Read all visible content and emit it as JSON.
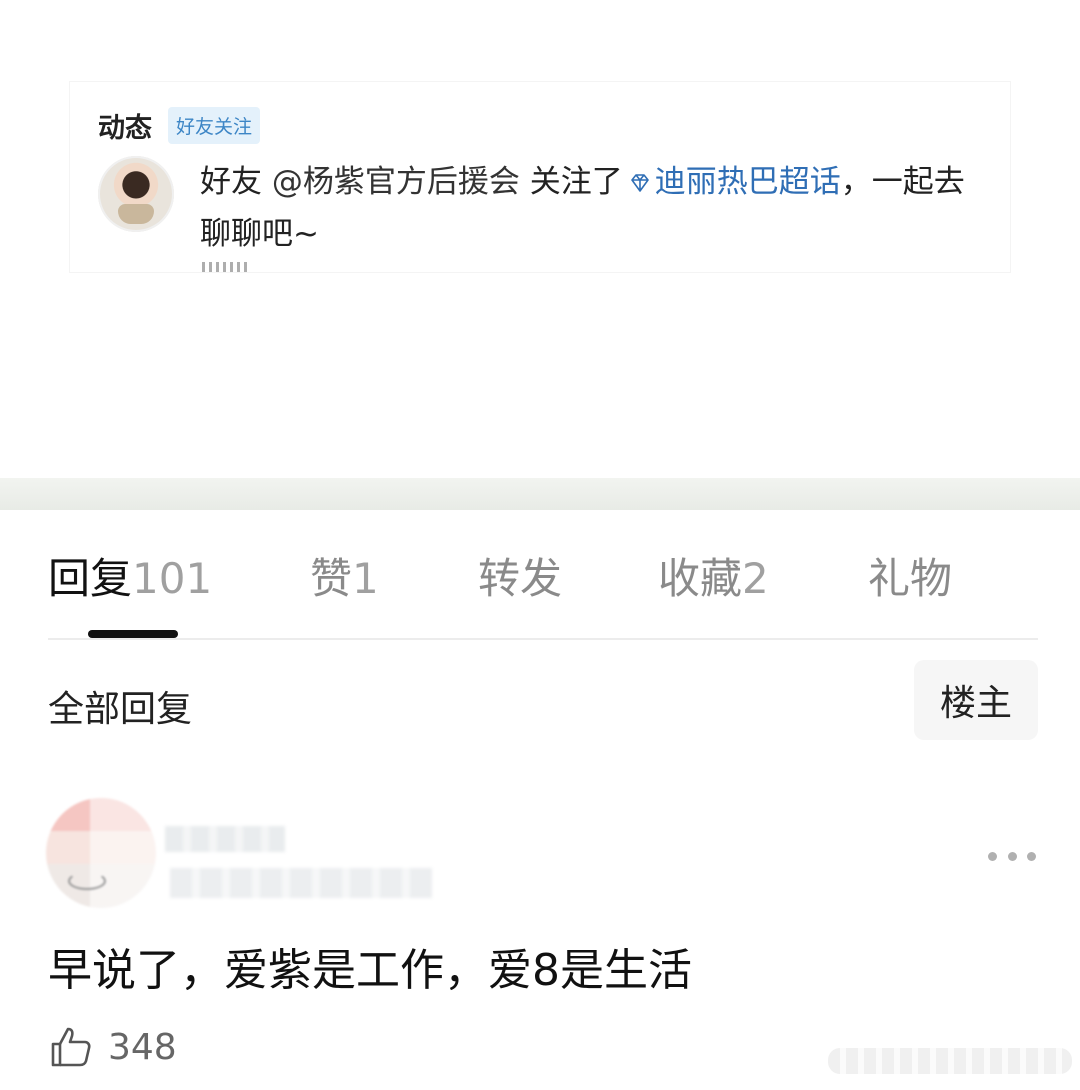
{
  "activity": {
    "title": "动态",
    "tag": "好友关注",
    "text_prefix": "好友 ",
    "mention": "@杨紫官方后援会",
    "text_mid": " 关注了",
    "diamond_icon": "diamond-icon",
    "topic": "迪丽热巴超话",
    "text_suffix": "，一起去聊聊吧~"
  },
  "tabs": [
    {
      "label": "回复",
      "count": "101",
      "active": true
    },
    {
      "label": "赞",
      "count": "1",
      "active": false
    },
    {
      "label": "转发",
      "count": "",
      "active": false
    },
    {
      "label": "收藏",
      "count": "2",
      "active": false
    },
    {
      "label": "礼物",
      "count": "",
      "active": false
    }
  ],
  "filter": {
    "all_replies": "全部回复",
    "owner_only": "楼主"
  },
  "reply": {
    "text": "早说了，爱紫是工作，爱8是生活",
    "likes": "348"
  },
  "colors": {
    "topic_blue": "#2f6eb5",
    "tag_bg": "#e4f1fb",
    "tag_text": "#3d86c6"
  }
}
